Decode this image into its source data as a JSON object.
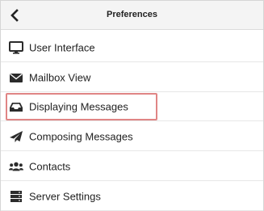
{
  "header": {
    "title": "Preferences",
    "back_icon": "chevron-left-icon"
  },
  "items": [
    {
      "label": "User Interface",
      "icon": "monitor-icon"
    },
    {
      "label": "Mailbox View",
      "icon": "envelope-icon"
    },
    {
      "label": "Displaying Messages",
      "icon": "inbox-tray-icon",
      "highlighted": true
    },
    {
      "label": "Composing Messages",
      "icon": "paper-plane-icon"
    },
    {
      "label": "Contacts",
      "icon": "users-icon"
    },
    {
      "label": "Server Settings",
      "icon": "server-icon"
    }
  ],
  "colors": {
    "icon": "#2b2b2b",
    "highlight_border": "#e08585",
    "header_bg": "#f4f4f4"
  }
}
